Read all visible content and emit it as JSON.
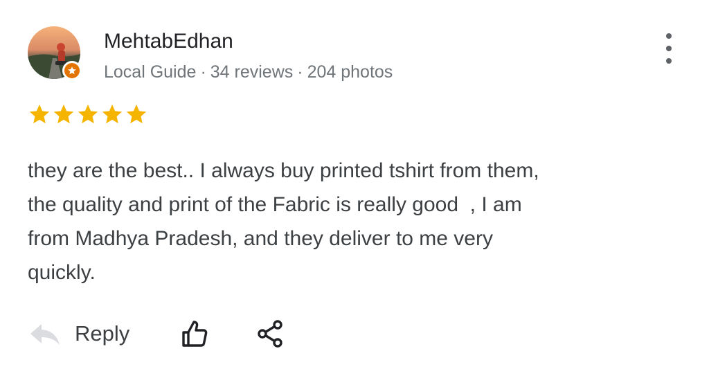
{
  "review": {
    "author_name": "MehtabEdhan",
    "author_badge": "Local Guide",
    "reviews_count": "34 reviews",
    "photos_count": "204 photos",
    "separator": "·",
    "rating": 5,
    "rating_max": 5,
    "text": "they are the best.. I always buy printed tshirt from them,\nthe quality and print of the Fabric is really good  , I am\nfrom Madhya Pradesh, and they deliver to me very\nquickly."
  },
  "actions": {
    "reply_label": "Reply",
    "reply_icon": "reply-arrow-icon",
    "like_icon": "thumbs-up-icon",
    "share_icon": "share-icon"
  },
  "menu": {
    "more_icon": "more-vert-icon"
  },
  "colors": {
    "star": "#f4b400",
    "badge": "#e37400",
    "meta_text": "#70757a",
    "icon": "#202124",
    "reply_icon": "#dadce0"
  }
}
